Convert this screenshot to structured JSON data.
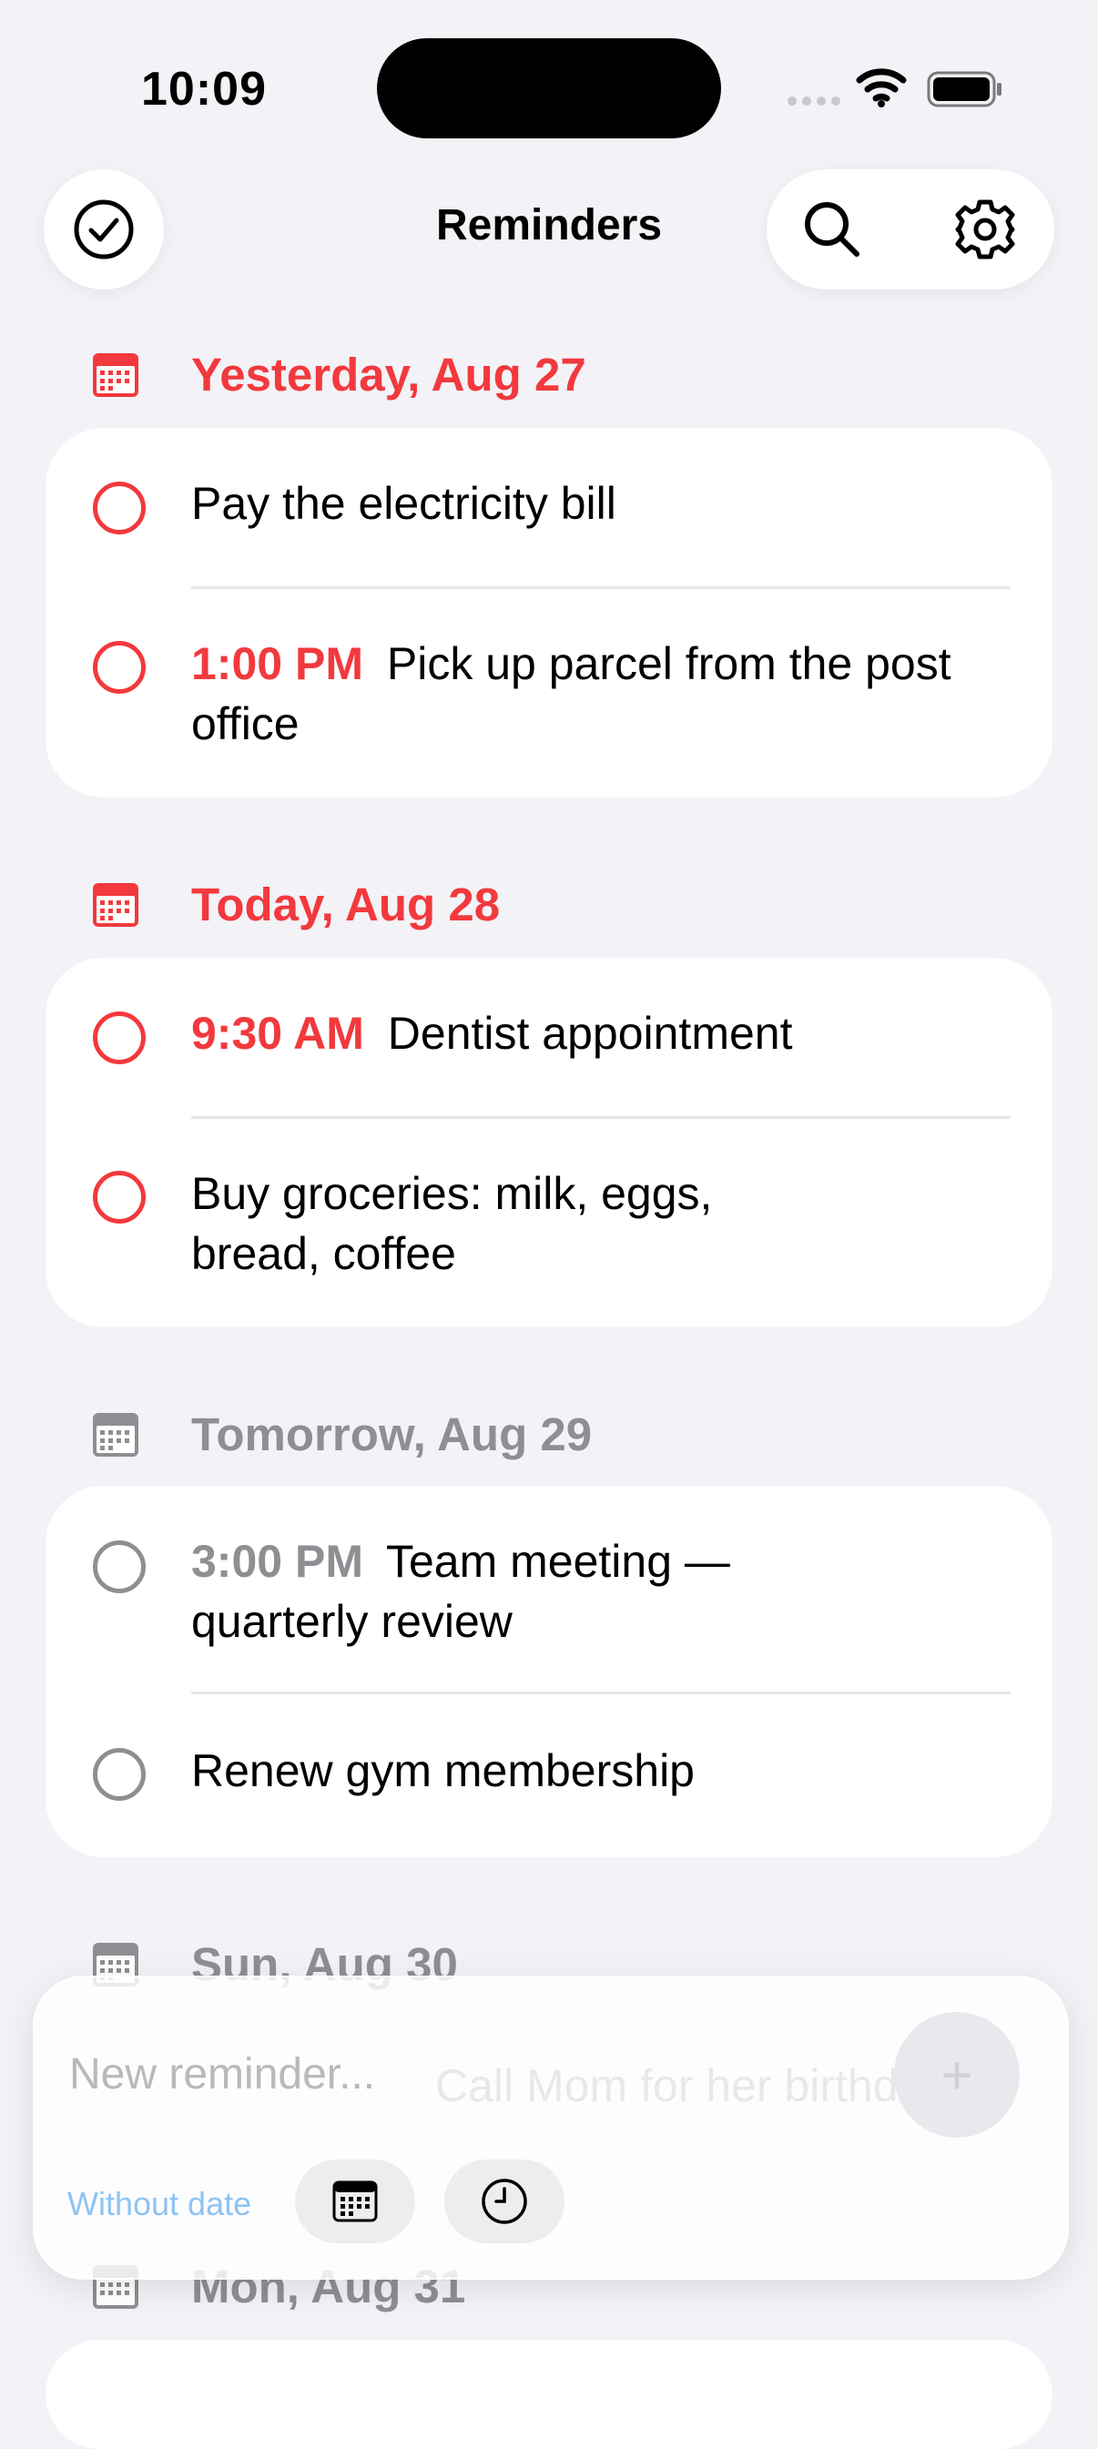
{
  "status_bar": {
    "time": "10:09"
  },
  "header": {
    "title": "Reminders"
  },
  "icons": {
    "done": "checkmark-circle-icon",
    "search": "search-icon",
    "settings": "gear-icon",
    "calendar": "calendar-icon",
    "clock": "clock-icon",
    "add": "plus-icon"
  },
  "colors": {
    "accent": "#f2393d",
    "muted": "#8e8e93",
    "link": "#8ec3f2"
  },
  "sections": [
    {
      "label": "Yesterday, Aug 27",
      "items": [
        {
          "time": "",
          "text": "Pay the electricity bill"
        },
        {
          "time": "1:00 PM",
          "text": "Pick up parcel from the post office"
        }
      ]
    },
    {
      "label": "Today, Aug 28",
      "items": [
        {
          "time": "9:30 AM",
          "text": "Dentist appointment"
        },
        {
          "time": "",
          "text": "Buy groceries: milk, eggs, bread, coffee"
        }
      ]
    },
    {
      "label": "Tomorrow, Aug 29",
      "items": [
        {
          "time": "3:00 PM",
          "text": "Team meeting — quarterly review"
        },
        {
          "time": "",
          "text": "Renew gym membership"
        }
      ]
    },
    {
      "label": "Sun, Aug 30",
      "items": [
        {
          "time": "",
          "text": "Call Mom for her birthday"
        }
      ]
    },
    {
      "label": "Mon, Aug 31",
      "items": []
    }
  ],
  "composer": {
    "placeholder": "New reminder...",
    "add_label": "+",
    "date_label": "Without date"
  }
}
